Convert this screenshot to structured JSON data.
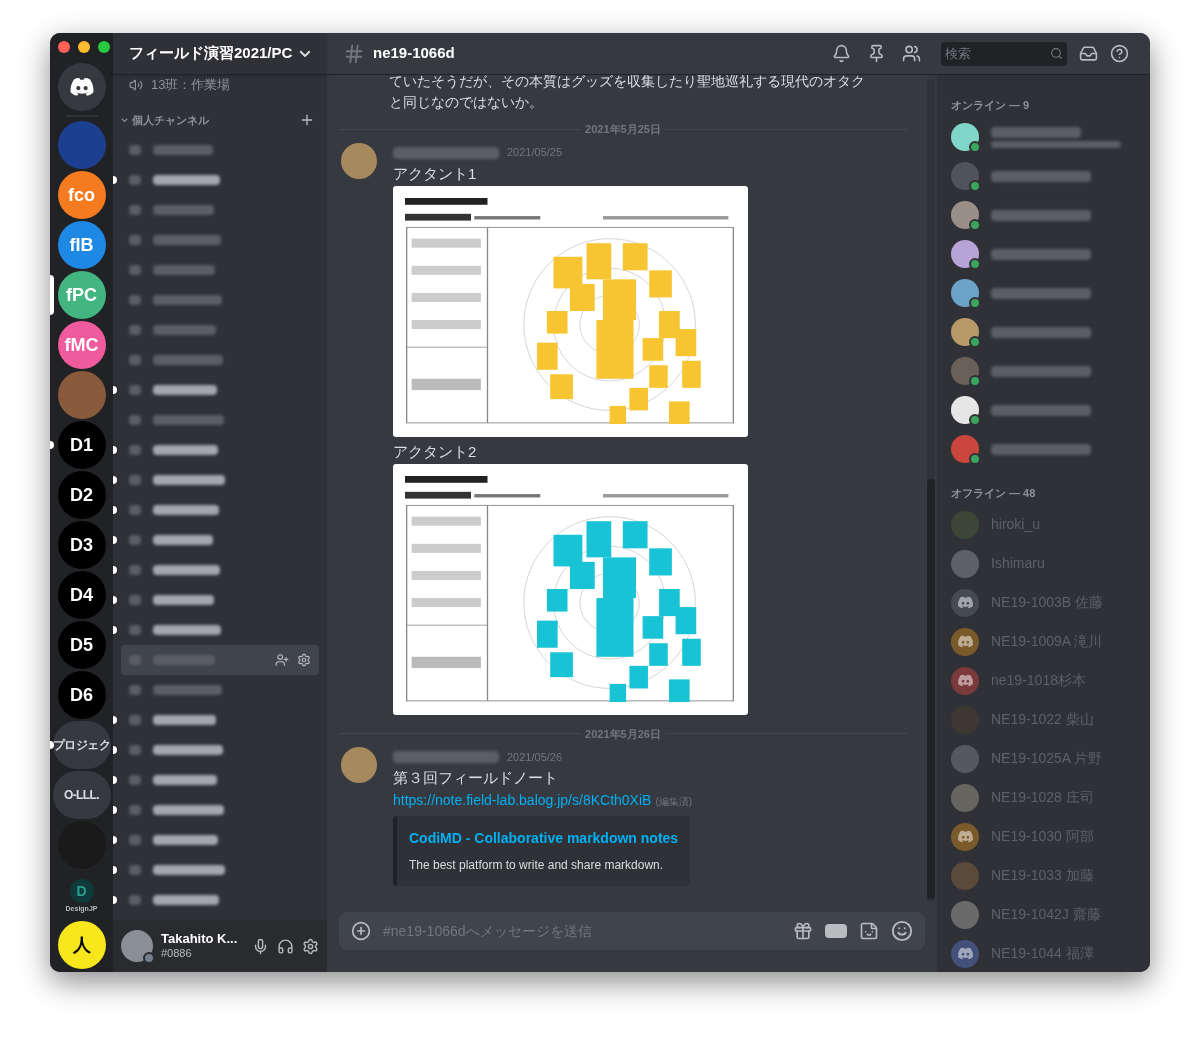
{
  "server_rail": {
    "servers": [
      {
        "kind": "home",
        "color": "#36393f",
        "unread": false,
        "selected": false
      },
      {
        "kind": "image",
        "color": "#1d3f8f",
        "unread": false,
        "selected": false
      },
      {
        "kind": "text",
        "label": "fco",
        "color": "#f47b20",
        "unread": false,
        "selected": false
      },
      {
        "kind": "text",
        "label": "fIB",
        "color": "#1e88e5",
        "unread": false,
        "selected": false
      },
      {
        "kind": "text",
        "label": "fPC",
        "color": "#43b581",
        "unread": false,
        "selected": true
      },
      {
        "kind": "text",
        "label": "fMC",
        "color": "#ef5b9c",
        "unread": false,
        "selected": false
      },
      {
        "kind": "image",
        "color": "#8a5a3c",
        "unread": false,
        "selected": false
      },
      {
        "kind": "text",
        "label": "D1",
        "color": "#000000",
        "unread": true,
        "selected": false
      },
      {
        "kind": "text",
        "label": "D2",
        "color": "#000000",
        "unread": false,
        "selected": false
      },
      {
        "kind": "text",
        "label": "D3",
        "color": "#000000",
        "unread": false,
        "selected": false
      },
      {
        "kind": "text",
        "label": "D4",
        "color": "#000000",
        "unread": false,
        "selected": false
      },
      {
        "kind": "text",
        "label": "D5",
        "color": "#000000",
        "unread": false,
        "selected": false
      },
      {
        "kind": "text",
        "label": "D6",
        "color": "#000000",
        "unread": false,
        "selected": false
      },
      {
        "kind": "text",
        "label": "プロジェク",
        "color": "#36393f",
        "unread": true,
        "selected": false
      },
      {
        "kind": "text",
        "label": "O-LLL.",
        "color": "#36393f",
        "unread": false,
        "selected": false
      },
      {
        "kind": "image",
        "color": "#1a1a1a",
        "unread": false,
        "selected": false
      },
      {
        "kind": "logo",
        "label": "DesignJP",
        "mark": "D",
        "color": "#202225",
        "unread": false,
        "selected": false
      },
      {
        "kind": "text",
        "label": "人",
        "color": "#f8e71c",
        "unread": false,
        "selected": false
      }
    ]
  },
  "sidebar": {
    "server_name": "フィールド演習2021/PC",
    "voice_channel": "13班：作業場",
    "category": "個人チャンネル",
    "channels": [
      {
        "unread": false,
        "selected": false
      },
      {
        "unread": true,
        "selected": false
      },
      {
        "unread": false,
        "selected": false
      },
      {
        "unread": false,
        "selected": false
      },
      {
        "unread": false,
        "selected": false
      },
      {
        "unread": false,
        "selected": false
      },
      {
        "unread": false,
        "selected": false
      },
      {
        "unread": false,
        "selected": false
      },
      {
        "unread": true,
        "selected": false
      },
      {
        "unread": false,
        "selected": false
      },
      {
        "unread": true,
        "selected": false
      },
      {
        "unread": true,
        "selected": false
      },
      {
        "unread": true,
        "selected": false
      },
      {
        "unread": true,
        "selected": false
      },
      {
        "unread": true,
        "selected": false
      },
      {
        "unread": true,
        "selected": false
      },
      {
        "unread": true,
        "selected": false
      },
      {
        "unread": false,
        "selected": true
      },
      {
        "unread": false,
        "selected": false
      },
      {
        "unread": true,
        "selected": false
      },
      {
        "unread": true,
        "selected": false
      },
      {
        "unread": true,
        "selected": false
      },
      {
        "unread": true,
        "selected": false
      },
      {
        "unread": true,
        "selected": false
      },
      {
        "unread": true,
        "selected": false
      },
      {
        "unread": true,
        "selected": false
      }
    ]
  },
  "user_panel": {
    "name": "Takahito K...",
    "tag": "#0886"
  },
  "chat": {
    "channel": "ne19-1066d",
    "search_placeholder": "検索",
    "prior_text": [
      "ていたそうだが、その本質はグッズを収集したり聖地巡礼する現代のオタク",
      "と同じなのではないか。"
    ],
    "groups": [
      {
        "date": "2021年5月25日",
        "timestamp": "2021/05/25",
        "content": [
          {
            "kind": "text",
            "text": "アクタント1"
          },
          {
            "kind": "image",
            "color": "#f7c531"
          },
          {
            "kind": "text",
            "text": "アクタント2"
          },
          {
            "kind": "image",
            "color": "#19c3d6"
          }
        ]
      },
      {
        "date": "2021年5月26日",
        "timestamp": "2021/05/26",
        "content": [
          {
            "kind": "text",
            "text": "第３回フィールドノート"
          },
          {
            "kind": "link",
            "text": "https://note.field-lab.balog.jp/s/8KCth0XiB",
            "note": "(編集済)"
          },
          {
            "kind": "embed",
            "title": "CodiMD - Collaborative markdown notes",
            "text": "The best platform to write and share markdown."
          }
        ]
      }
    ],
    "input_placeholder": "#ne19-1066dへメッセージを送信"
  },
  "members": {
    "online_header": "オンライン — 9",
    "online": [
      {
        "color": "#7fd6c9",
        "two_lines": true
      },
      {
        "color": "#4f545c",
        "two_lines": false
      },
      {
        "color": "#9a8f86",
        "two_lines": false
      },
      {
        "color": "#b7a3d6",
        "two_lines": false
      },
      {
        "color": "#6aa2c8",
        "two_lines": false
      },
      {
        "color": "#b89a6a",
        "two_lines": false
      },
      {
        "color": "#6b6058",
        "two_lines": false
      },
      {
        "color": "#e6e6e6",
        "two_lines": false
      },
      {
        "color": "#c8463b",
        "two_lines": false
      }
    ],
    "offline_header": "オフライン — 48",
    "offline": [
      {
        "name": "hiroki_u",
        "kind": "photo",
        "color": "#3c4636"
      },
      {
        "name": "Ishimaru",
        "kind": "photo",
        "color": "#5f6066"
      },
      {
        "name": "NE19-1003B 佐藤",
        "kind": "default",
        "color": "#454a53"
      },
      {
        "name": "NE19-1009A 滝川",
        "kind": "default",
        "color": "#7a5a2a"
      },
      {
        "name": "ne19-1018杉本",
        "kind": "default",
        "color": "#7a3a3c"
      },
      {
        "name": "NE19-1022 柴山",
        "kind": "photo",
        "color": "#3e3832"
      },
      {
        "name": "NE19-1025A 片野",
        "kind": "photo",
        "color": "#55585c"
      },
      {
        "name": "NE19-1028 庄司",
        "kind": "photo",
        "color": "#66655f"
      },
      {
        "name": "NE19-1030 阿部",
        "kind": "default",
        "color": "#7a5a2a"
      },
      {
        "name": "NE19-1033 加藤",
        "kind": "photo",
        "color": "#5a4a3a"
      },
      {
        "name": "NE19-1042J 齋藤",
        "kind": "photo",
        "color": "#6a6a6a"
      },
      {
        "name": "NE19-1044 福澤",
        "kind": "default",
        "color": "#42507a"
      }
    ]
  }
}
